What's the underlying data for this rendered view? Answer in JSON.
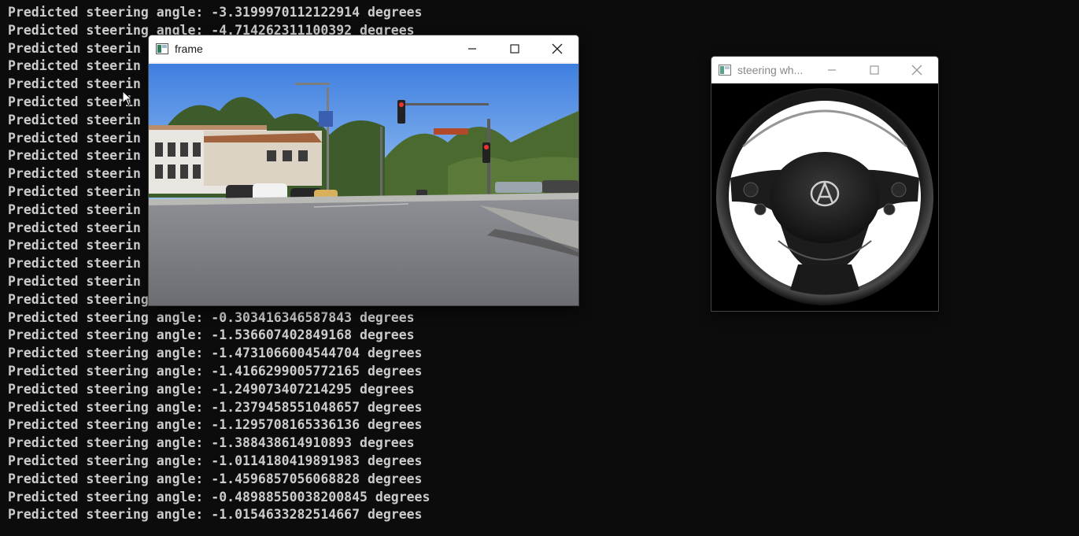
{
  "terminal": {
    "lines": [
      "Predicted steering angle: -3.3199970112122914 degrees",
      "Predicted steering angle: -4.714262311100392 degrees",
      "Predicted steerin",
      "Predicted steerin",
      "Predicted steerin",
      "Predicted steerin",
      "Predicted steerin",
      "Predicted steerin",
      "Predicted steerin",
      "Predicted steerin",
      "Predicted steerin",
      "Predicted steerin",
      "Predicted steerin",
      "Predicted steerin",
      "Predicted steerin",
      "Predicted steerin",
      "Predicted steering",
      "Predicted steering angle: -0.303416346587843 degrees",
      "Predicted steering angle: -1.536607402849168 degrees",
      "Predicted steering angle: -1.4731066004544704 degrees",
      "Predicted steering angle: -1.4166299005772165 degrees",
      "Predicted steering angle: -1.249073407214295 degrees",
      "Predicted steering angle: -1.2379458551048657 degrees",
      "Predicted steering angle: -1.1295708165336136 degrees",
      "Predicted steering angle: -1.388438614910893 degrees",
      "Predicted steering angle: -1.0114180419891983 degrees",
      "Predicted steering angle: -1.4596857056068828 degrees",
      "Predicted steering angle: -0.48988550038200845 degrees",
      "Predicted steering angle: -1.0154633282514667 degrees"
    ],
    "text_color": "#cccccc",
    "background": "#0c0c0c"
  },
  "frame_window": {
    "title": "frame",
    "icons": [
      "app-icon",
      "minimize-icon",
      "maximize-icon",
      "close-icon"
    ]
  },
  "wheel_window": {
    "title": "steering wh...",
    "icons": [
      "app-icon",
      "minimize-icon",
      "maximize-icon",
      "close-icon"
    ]
  }
}
